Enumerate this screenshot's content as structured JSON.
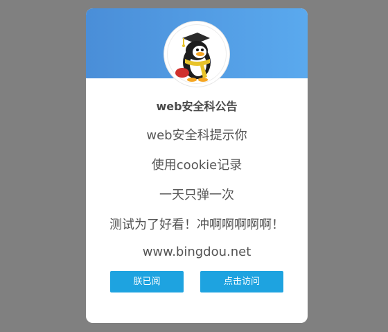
{
  "notice": {
    "title": "web安全科公告",
    "lines": [
      "web安全科提示你",
      "使用cookie记录",
      "一天只弹一次",
      "测试为了好看！冲啊啊啊啊啊！",
      "www.bingdou.net"
    ],
    "buttons": {
      "read": "朕已阅",
      "visit": "点击访问"
    },
    "avatar_icon": "penguin-graduate-icon"
  },
  "colors": {
    "header_gradient_start": "#4a8ed8",
    "header_gradient_end": "#5aa9ee",
    "button": "#1ea3e0",
    "overlay": "#808080"
  }
}
